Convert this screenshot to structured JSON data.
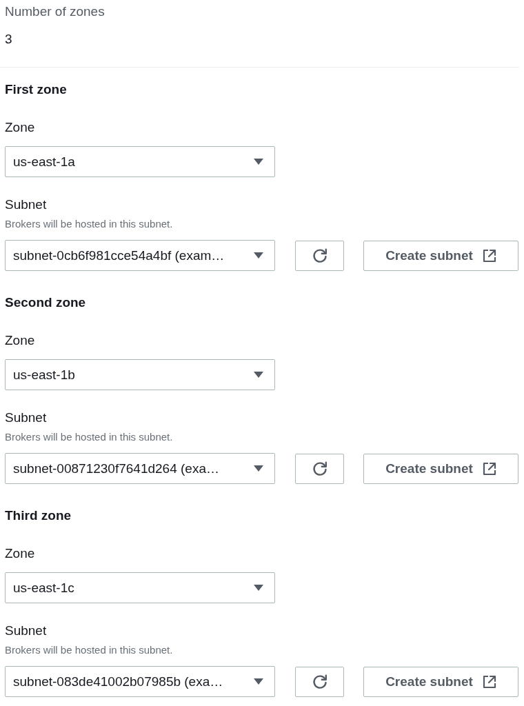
{
  "number_of_zones": {
    "label": "Number of zones",
    "value": "3"
  },
  "zones": [
    {
      "heading": "First zone",
      "zone": {
        "label": "Zone",
        "value": "us-east-1a"
      },
      "subnet": {
        "label": "Subnet",
        "description": "Brokers will be hosted in this subnet.",
        "value": "subnet-0cb6f981cce54a4bf (exam…"
      },
      "create_button": {
        "label": "Create subnet"
      }
    },
    {
      "heading": "Second zone",
      "zone": {
        "label": "Zone",
        "value": "us-east-1b"
      },
      "subnet": {
        "label": "Subnet",
        "description": "Brokers will be hosted in this subnet.",
        "value": "subnet-00871230f7641d264 (exa…"
      },
      "create_button": {
        "label": "Create subnet"
      }
    },
    {
      "heading": "Third zone",
      "zone": {
        "label": "Zone",
        "value": "us-east-1c"
      },
      "subnet": {
        "label": "Subnet",
        "description": "Brokers will be hosted in this subnet.",
        "value": "subnet-083de41002b07985b (exa…"
      },
      "create_button": {
        "label": "Create subnet"
      }
    }
  ]
}
